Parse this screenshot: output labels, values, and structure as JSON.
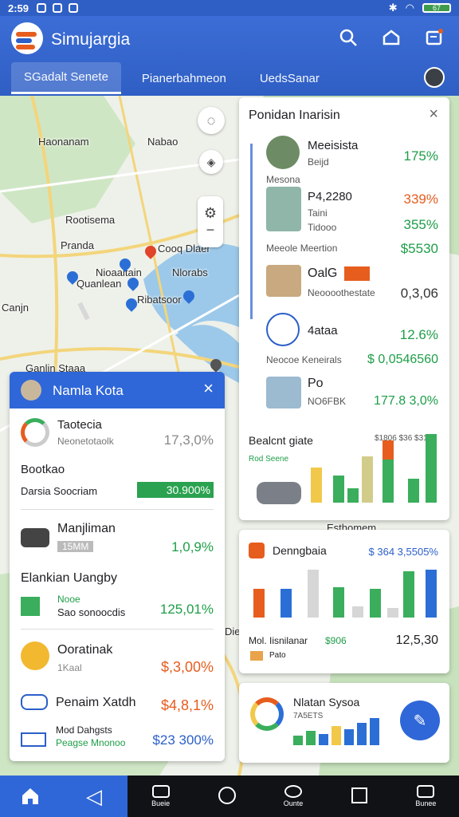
{
  "status": {
    "time": "2:59",
    "battery": "67"
  },
  "app": {
    "title": "Simujargia"
  },
  "tabs": [
    {
      "label": "SGadalt Senete"
    },
    {
      "label": "Pianerbahmeon"
    },
    {
      "label": "UedsSanar"
    }
  ],
  "icons": {
    "search": "search-icon",
    "home_alt": "home-alt-icon",
    "notifications": "notification-icon",
    "close": "close-icon",
    "home": "home-icon",
    "back": "back-icon"
  },
  "map": {
    "labels": [
      "Haonanam",
      "Nabao",
      "Rootisema",
      "Pranda",
      "Cooq Dlaer",
      "Nioaaltain",
      "Nlorabs",
      "Quanlean",
      "Ribatsoor",
      "Ganlin Staaa",
      "Canjn",
      "Esthomem",
      "Dieat"
    ]
  },
  "right_panel": {
    "title": "Ponidan Inarisin",
    "items": [
      {
        "name": "Meeisista",
        "sub": "Beijd",
        "value": "175%"
      },
      {
        "name": "Mesona",
        "sub": "",
        "value": ""
      },
      {
        "name": "P4,2280",
        "sub": "Taini",
        "value": "339%"
      },
      {
        "name": "",
        "sub": "Tidooo",
        "value": "355%"
      },
      {
        "name": "Meeole Meertion",
        "sub": "",
        "value": "$5530"
      },
      {
        "name": "OalG",
        "sub": "Neoooothestate",
        "value": "0,3,06"
      },
      {
        "name": "4ataa",
        "sub": "",
        "value": "12.6%"
      },
      {
        "name": "Neocoe Keneirals",
        "sub": "",
        "value": "$ 0,0546560"
      },
      {
        "name": "Po",
        "sub": "NO6FBK",
        "value": "177.8 3,0%"
      }
    ],
    "chart": {
      "title": "Bealcnt giate",
      "sub": "Rod Seene",
      "legend": "$1806 $36 $31"
    }
  },
  "left_panel": {
    "title": "Namla Kota",
    "items": [
      {
        "name": "Taotecia",
        "sub": "Neonetotaolk",
        "value": "17,3,0%"
      },
      {
        "name": "Bootkao",
        "sub": "Darsia Soocriam",
        "value": "30.900%"
      },
      {
        "name": "Manjliman",
        "sub": "15MM",
        "value": "1,0,9%"
      },
      {
        "name": "Elankian Uangby",
        "sub": "",
        "value": ""
      },
      {
        "name": "Nooe",
        "sub": "Sao sonoocdis",
        "value": "125,01%"
      },
      {
        "name": "Ooratinak",
        "sub": "1Kaal",
        "value": "$,3,00%"
      },
      {
        "name": "Penaim Xatdh",
        "sub": "",
        "value": "$4,8,1%"
      },
      {
        "name": "Mod Dahgsts",
        "sub": "Peagse Mnonoo",
        "value": "$23 300%"
      }
    ]
  },
  "card2": {
    "title": "Denngbaia",
    "value": "$ 364 3,5505%",
    "footer_label": "Mol. Iisnilanar",
    "footer_value": "$906",
    "footer_total": "12,5,30",
    "footer_sub": "Pato"
  },
  "card3": {
    "title": "Nlatan Sysoa",
    "sub": "7A5ETS"
  },
  "nav": [
    {
      "label": "Bueie"
    },
    {
      "label": ""
    },
    {
      "label": "Ounte"
    },
    {
      "label": ""
    },
    {
      "label": "Bunee"
    }
  ],
  "colors": {
    "primary": "#2f5fc4",
    "green": "#1e9e48",
    "orange": "#e65d1e",
    "blue": "#2b5fc9"
  }
}
